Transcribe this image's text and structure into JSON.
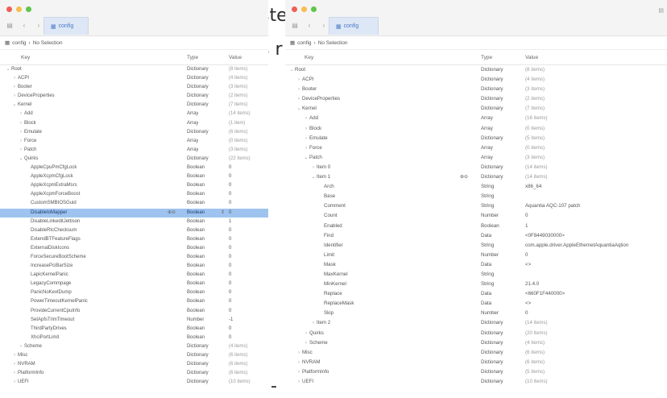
{
  "background_text": {
    "line1": "ste",
    "line2": "s r",
    "line3": "-"
  },
  "left": {
    "tab_label": "config",
    "path": {
      "file": "config",
      "selection": "No Selection"
    },
    "columns": {
      "key": "Key",
      "type": "Type",
      "value": "Value"
    },
    "rows": [
      {
        "key": "Root",
        "type": "Dictionary",
        "value": "(8 items)",
        "indent": 0,
        "chev": "v"
      },
      {
        "key": "ACPI",
        "type": "Dictionary",
        "value": "(4 items)",
        "indent": 1,
        "chev": ">"
      },
      {
        "key": "Booter",
        "type": "Dictionary",
        "value": "(3 items)",
        "indent": 1,
        "chev": ">"
      },
      {
        "key": "DeviceProperties",
        "type": "Dictionary",
        "value": "(2 items)",
        "indent": 1,
        "chev": ">"
      },
      {
        "key": "Kernel",
        "type": "Dictionary",
        "value": "(7 items)",
        "indent": 1,
        "chev": "v"
      },
      {
        "key": "Add",
        "type": "Array",
        "value": "(14 items)",
        "indent": 2,
        "chev": ">"
      },
      {
        "key": "Block",
        "type": "Array",
        "value": "(1 item)",
        "indent": 2,
        "chev": ">"
      },
      {
        "key": "Emulate",
        "type": "Dictionary",
        "value": "(6 items)",
        "indent": 2,
        "chev": ">"
      },
      {
        "key": "Force",
        "type": "Array",
        "value": "(0 items)",
        "indent": 2,
        "chev": ">"
      },
      {
        "key": "Patch",
        "type": "Array",
        "value": "(3 items)",
        "indent": 2,
        "chev": ">"
      },
      {
        "key": "Quirks",
        "type": "Dictionary",
        "value": "(22 items)",
        "indent": 2,
        "chev": "v"
      },
      {
        "key": "AppleCpuPmCfgLock",
        "type": "Boolean",
        "value": "0",
        "indent": 3,
        "chev": ""
      },
      {
        "key": "AppleXcpmCfgLock",
        "type": "Boolean",
        "value": "0",
        "indent": 3,
        "chev": ""
      },
      {
        "key": "AppleXcpmExtraMsrs",
        "type": "Boolean",
        "value": "0",
        "indent": 3,
        "chev": ""
      },
      {
        "key": "AppleXcpmForceBoost",
        "type": "Boolean",
        "value": "0",
        "indent": 3,
        "chev": ""
      },
      {
        "key": "CustomSMBIOSGuid",
        "type": "Boolean",
        "value": "0",
        "indent": 3,
        "chev": ""
      },
      {
        "key": "DisableIoMapper",
        "type": "Boolean",
        "value": "0",
        "indent": 3,
        "chev": "",
        "selected": true
      },
      {
        "key": "DisableLinkeditJettison",
        "type": "Boolean",
        "value": "1",
        "indent": 3,
        "chev": ""
      },
      {
        "key": "DisableRtcChecksum",
        "type": "Boolean",
        "value": "0",
        "indent": 3,
        "chev": ""
      },
      {
        "key": "ExtendBTFeatureFlags",
        "type": "Boolean",
        "value": "0",
        "indent": 3,
        "chev": ""
      },
      {
        "key": "ExternalDiskIcons",
        "type": "Boolean",
        "value": "0",
        "indent": 3,
        "chev": ""
      },
      {
        "key": "ForceSecureBootScheme",
        "type": "Boolean",
        "value": "0",
        "indent": 3,
        "chev": ""
      },
      {
        "key": "IncreasePciBarSize",
        "type": "Boolean",
        "value": "0",
        "indent": 3,
        "chev": ""
      },
      {
        "key": "LapicKernelPanic",
        "type": "Boolean",
        "value": "0",
        "indent": 3,
        "chev": ""
      },
      {
        "key": "LegacyCommpage",
        "type": "Boolean",
        "value": "0",
        "indent": 3,
        "chev": ""
      },
      {
        "key": "PanicNoKextDump",
        "type": "Boolean",
        "value": "0",
        "indent": 3,
        "chev": ""
      },
      {
        "key": "PowerTimeoutKernelPanic",
        "type": "Boolean",
        "value": "0",
        "indent": 3,
        "chev": ""
      },
      {
        "key": "ProvideCurrentCpuInfo",
        "type": "Boolean",
        "value": "0",
        "indent": 3,
        "chev": ""
      },
      {
        "key": "SetApfsTrimTimeout",
        "type": "Number",
        "value": "-1",
        "indent": 3,
        "chev": ""
      },
      {
        "key": "ThirdPartyDrives",
        "type": "Boolean",
        "value": "0",
        "indent": 3,
        "chev": ""
      },
      {
        "key": "XhciPortLimit",
        "type": "Boolean",
        "value": "0",
        "indent": 3,
        "chev": ""
      },
      {
        "key": "Scheme",
        "type": "Dictionary",
        "value": "(4 items)",
        "indent": 2,
        "chev": ">"
      },
      {
        "key": "Misc",
        "type": "Dictionary",
        "value": "(6 items)",
        "indent": 1,
        "chev": ">"
      },
      {
        "key": "NVRAM",
        "type": "Dictionary",
        "value": "(6 items)",
        "indent": 1,
        "chev": ">"
      },
      {
        "key": "PlatformInfo",
        "type": "Dictionary",
        "value": "(6 items)",
        "indent": 1,
        "chev": ">"
      },
      {
        "key": "UEFI",
        "type": "Dictionary",
        "value": "(10 items)",
        "indent": 1,
        "chev": ">"
      }
    ]
  },
  "right": {
    "tab_label": "config",
    "path": {
      "file": "config",
      "selection": "No Selection"
    },
    "columns": {
      "key": "Key",
      "type": "Type",
      "value": "Value"
    },
    "rows": [
      {
        "key": "Root",
        "type": "Dictionary",
        "value": "(8 items)",
        "indent": 0,
        "chev": "v"
      },
      {
        "key": "ACPI",
        "type": "Dictionary",
        "value": "(4 items)",
        "indent": 1,
        "chev": ">"
      },
      {
        "key": "Booter",
        "type": "Dictionary",
        "value": "(3 items)",
        "indent": 1,
        "chev": ">"
      },
      {
        "key": "DeviceProperties",
        "type": "Dictionary",
        "value": "(2 items)",
        "indent": 1,
        "chev": ">"
      },
      {
        "key": "Kernel",
        "type": "Dictionary",
        "value": "(7 items)",
        "indent": 1,
        "chev": "v"
      },
      {
        "key": "Add",
        "type": "Array",
        "value": "(16 items)",
        "indent": 2,
        "chev": ">"
      },
      {
        "key": "Block",
        "type": "Array",
        "value": "(0 items)",
        "indent": 2,
        "chev": ">"
      },
      {
        "key": "Emulate",
        "type": "Dictionary",
        "value": "(5 items)",
        "indent": 2,
        "chev": ">"
      },
      {
        "key": "Force",
        "type": "Array",
        "value": "(0 items)",
        "indent": 2,
        "chev": ">"
      },
      {
        "key": "Patch",
        "type": "Array",
        "value": "(3 items)",
        "indent": 2,
        "chev": "v"
      },
      {
        "key": "Item 0",
        "type": "Dictionary",
        "value": "(14 items)",
        "indent": 3,
        "chev": ">"
      },
      {
        "key": "Item 1",
        "type": "Dictionary",
        "value": "(14 items)",
        "indent": 3,
        "chev": "v",
        "buttons": true
      },
      {
        "key": "Arch",
        "type": "String",
        "value": "x86_64",
        "indent": 4,
        "chev": "",
        "strong": true
      },
      {
        "key": "Base",
        "type": "String",
        "value": "",
        "indent": 4,
        "chev": ""
      },
      {
        "key": "Comment",
        "type": "String",
        "value": "Aquantia AQC-107 patch",
        "indent": 4,
        "chev": "",
        "strong": true
      },
      {
        "key": "Count",
        "type": "Number",
        "value": "0",
        "indent": 4,
        "chev": "",
        "strong": true
      },
      {
        "key": "Enabled",
        "type": "Boolean",
        "value": "1",
        "indent": 4,
        "chev": "",
        "strong": true
      },
      {
        "key": "Find",
        "type": "Data",
        "value": "<0F8449030000>",
        "indent": 4,
        "chev": "",
        "strong": true
      },
      {
        "key": "Identifier",
        "type": "String",
        "value": "com.apple.driver.AppleEthernetAquantiaAqtion",
        "indent": 4,
        "chev": "",
        "strong": true
      },
      {
        "key": "Limit",
        "type": "Number",
        "value": "0",
        "indent": 4,
        "chev": "",
        "strong": true
      },
      {
        "key": "Mask",
        "type": "Data",
        "value": "<>",
        "indent": 4,
        "chev": "",
        "strong": true
      },
      {
        "key": "MaxKernel",
        "type": "String",
        "value": "",
        "indent": 4,
        "chev": ""
      },
      {
        "key": "MinKernel",
        "type": "String",
        "value": "21.4.0",
        "indent": 4,
        "chev": "",
        "strong": true
      },
      {
        "key": "Replace",
        "type": "Data",
        "value": "<660F1F440000>",
        "indent": 4,
        "chev": "",
        "strong": true
      },
      {
        "key": "ReplaceMask",
        "type": "Data",
        "value": "<>",
        "indent": 4,
        "chev": "",
        "strong": true
      },
      {
        "key": "Skip",
        "type": "Number",
        "value": "0",
        "indent": 4,
        "chev": "",
        "strong": true
      },
      {
        "key": "Item 2",
        "type": "Dictionary",
        "value": "(14 items)",
        "indent": 3,
        "chev": ">"
      },
      {
        "key": "Quirks",
        "type": "Dictionary",
        "value": "(20 items)",
        "indent": 2,
        "chev": ">"
      },
      {
        "key": "Scheme",
        "type": "Dictionary",
        "value": "(4 items)",
        "indent": 2,
        "chev": ">"
      },
      {
        "key": "Misc",
        "type": "Dictionary",
        "value": "(6 items)",
        "indent": 1,
        "chev": ">"
      },
      {
        "key": "NVRAM",
        "type": "Dictionary",
        "value": "(6 items)",
        "indent": 1,
        "chev": ">"
      },
      {
        "key": "PlatformInfo",
        "type": "Dictionary",
        "value": "(5 items)",
        "indent": 1,
        "chev": ">"
      },
      {
        "key": "UEFI",
        "type": "Dictionary",
        "value": "(10 items)",
        "indent": 1,
        "chev": ">"
      }
    ]
  },
  "icons": {
    "sidebar": "sidebar-icon",
    "back": "chevron-left-icon",
    "forward": "chevron-right-icon",
    "file": "plist-file-icon",
    "add": "plus-icon",
    "remove": "minus-icon",
    "stepper": "stepper-icon"
  },
  "colors": {
    "selection": "#9ec3ef",
    "tab": "#dde7f5",
    "tab_text": "#4a7ac9",
    "close": "#ee5f57",
    "minimize": "#f6be4f",
    "zoom": "#5fc64b"
  }
}
